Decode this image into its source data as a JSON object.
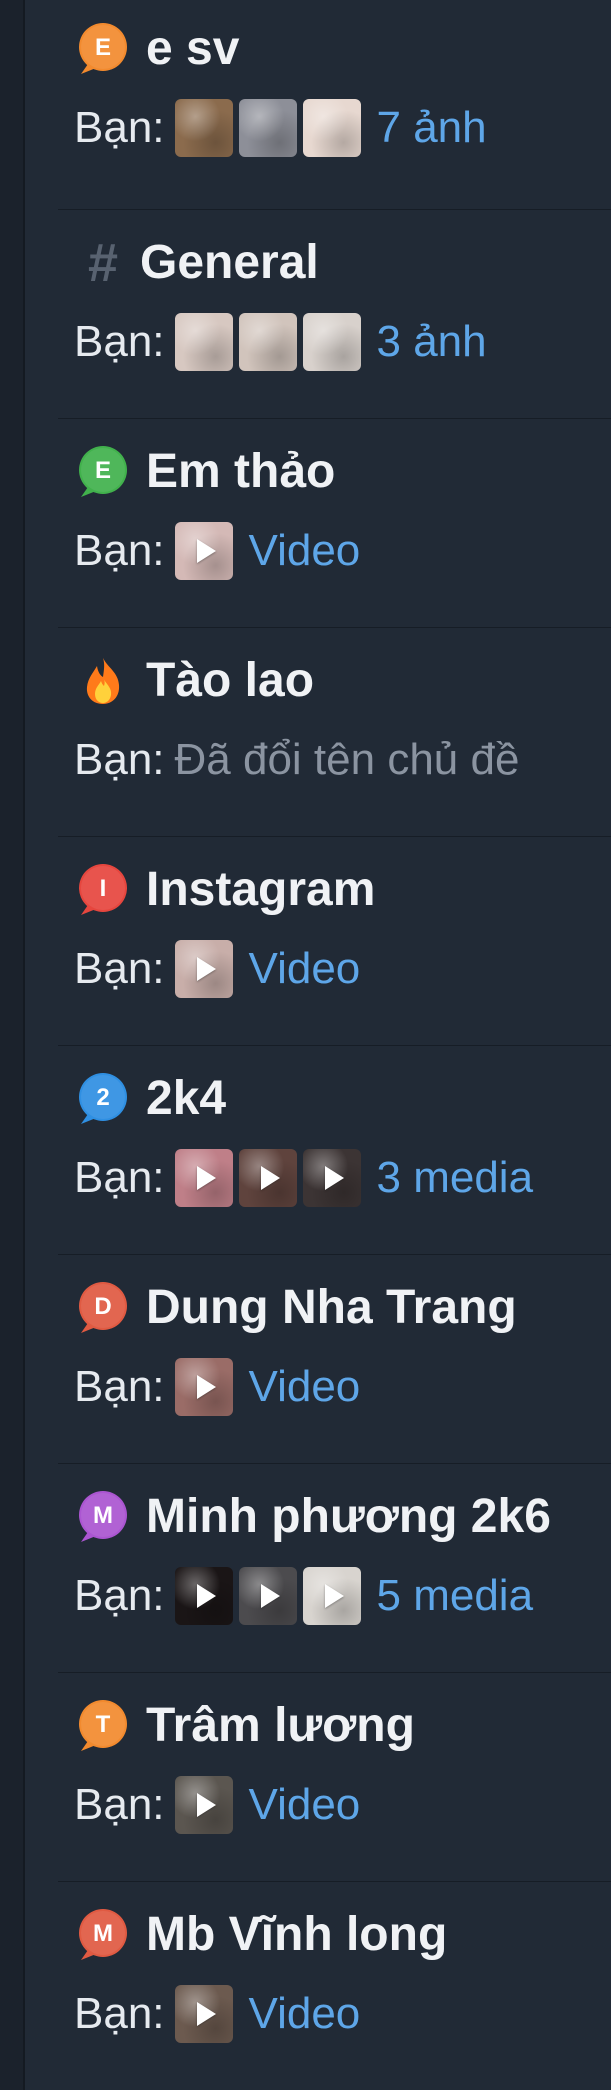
{
  "sender_label": "Bạn:",
  "topics": [
    {
      "title": "e sv",
      "icon": {
        "name": "bubble-icon",
        "letter": "E",
        "color": "#f28a2e"
      },
      "preview": "7 ảnh",
      "thumb_colors": [
        "#8b6b4d",
        "#8d8f98",
        "#e7d8d0"
      ]
    },
    {
      "title": "General",
      "icon": {
        "name": "hashtag-icon",
        "color": "#586270"
      },
      "preview": "3 ảnh",
      "thumb_colors": [
        "#d7c8c1",
        "#d1c4bc",
        "#d8d1cc"
      ]
    },
    {
      "title": "Em thảo",
      "icon": {
        "name": "bubble-icon",
        "letter": "E",
        "color": "#41b14c"
      },
      "preview": "Video",
      "thumb_colors": [
        "#d4b9b6"
      ]
    },
    {
      "title": "Tào lao",
      "icon": {
        "name": "fire-icon",
        "color": "#ff7a1a"
      },
      "preview": "Đã đổi tên chủ đề",
      "thumb_colors": []
    },
    {
      "title": "Instagram",
      "icon": {
        "name": "bubble-icon",
        "letter": "I",
        "color": "#e6463e"
      },
      "preview": "Video",
      "thumb_colors": [
        "#c8aea9"
      ]
    },
    {
      "title": "2k4",
      "icon": {
        "name": "bubble-icon",
        "letter": "2",
        "color": "#2f8fe2"
      },
      "preview": "3 media",
      "thumb_colors": [
        "#bf7f88",
        "#5f433d",
        "#3c3434"
      ]
    },
    {
      "title": "Dung Nha Trang",
      "icon": {
        "name": "bubble-icon",
        "letter": "D",
        "color": "#e05a42"
      },
      "preview": "Video",
      "thumb_colors": [
        "#9a6c67"
      ]
    },
    {
      "title": "Minh phương 2k6",
      "icon": {
        "name": "bubble-icon",
        "letter": "M",
        "color": "#ab55d1"
      },
      "preview": "5 media",
      "thumb_colors": [
        "#1a1516",
        "#4c4b4e",
        "#d8d4cf"
      ]
    },
    {
      "title": "Trâm lương",
      "icon": {
        "name": "bubble-icon",
        "letter": "T",
        "color": "#f28a2e"
      },
      "preview": "Video",
      "thumb_colors": [
        "#5b5650"
      ]
    },
    {
      "title": "Mb Vĩnh long",
      "icon": {
        "name": "bubble-icon",
        "letter": "M",
        "color": "#e05a42"
      },
      "preview": "Video",
      "thumb_colors": [
        "#6c5a4f"
      ]
    }
  ],
  "colors": {
    "background": "#212a36",
    "title_text": "#f0f2f5",
    "sender_text": "#e6eaef",
    "link": "#5ea6e8",
    "muted": "#8b94a1",
    "divider": "#161d26"
  }
}
